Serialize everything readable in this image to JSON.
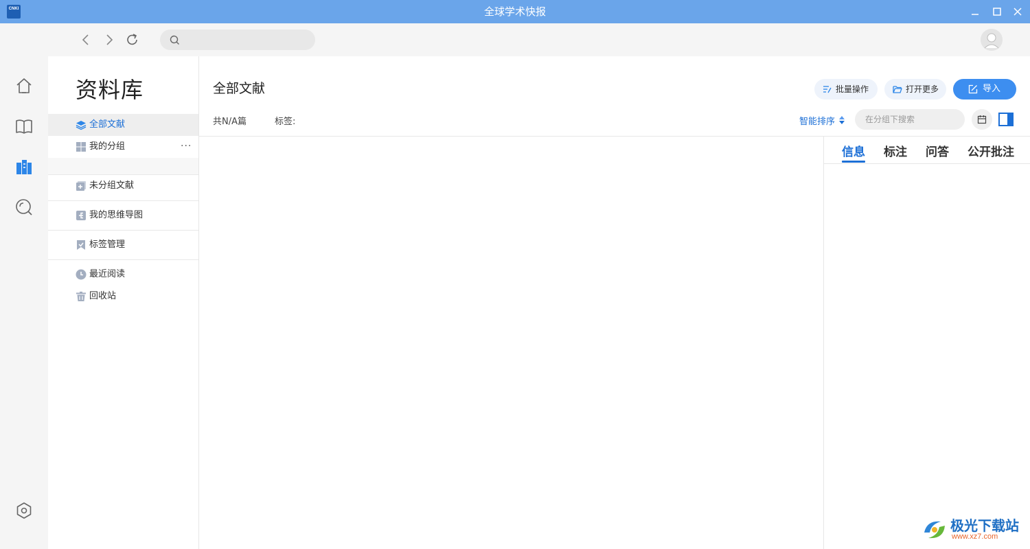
{
  "window": {
    "title": "全球学术快报",
    "logo_text": "CNKI",
    "logo_sub": "全球学术快报"
  },
  "rail": {
    "items": [
      "home-icon",
      "book-icon",
      "library-icon",
      "discover-icon",
      "settings-icon"
    ],
    "active": "library-icon"
  },
  "navbar": {
    "search_placeholder": ""
  },
  "library": {
    "title": "资料库",
    "items": [
      {
        "label": "全部文献",
        "icon": "layers-icon",
        "active": true
      },
      {
        "label": "我的分组",
        "icon": "grid-icon",
        "more": "···"
      },
      {
        "label": "未分组文献",
        "icon": "add-doc-icon"
      },
      {
        "label": "我的思维导图",
        "icon": "mindmap-icon"
      },
      {
        "label": "标签管理",
        "icon": "bookmark-icon"
      },
      {
        "label": "最近阅读",
        "icon": "clock-icon"
      },
      {
        "label": "回收站",
        "icon": "trash-icon"
      }
    ]
  },
  "main": {
    "title": "全部文献",
    "count": "共N/A篇",
    "tags_label": "标签:",
    "batch_label": "批量操作",
    "open_more_label": "打开更多",
    "import_label": "导入",
    "sort_label": "智能排序",
    "group_search_placeholder": "在分组下搜索"
  },
  "right_panel": {
    "tabs": [
      "信息",
      "标注",
      "问答",
      "公开批注"
    ],
    "active_tab": "信息"
  },
  "watermark": {
    "name": "极光下载站",
    "url": "www.xz7.com"
  },
  "colors": {
    "titlebar": "#6aa5ea",
    "accent": "#1c6fd6",
    "import_button": "#3d8ef0"
  }
}
